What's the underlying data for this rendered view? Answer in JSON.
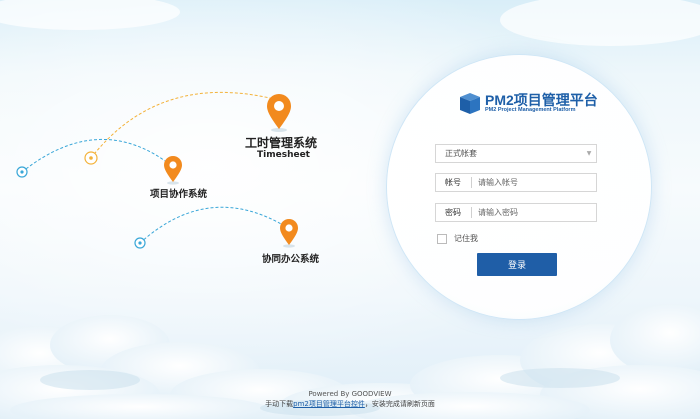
{
  "systems": [
    {
      "title": "工时管理系统",
      "subtitle": "Timesheet"
    },
    {
      "title": "项目协作系统"
    },
    {
      "title": "协同办公系统"
    }
  ],
  "brand": {
    "title": "PM2项目管理平台",
    "subtitle": "PM2 Project Management Platform",
    "color": "#1e5fa8"
  },
  "login": {
    "account_type": "正式帐套",
    "account_label": "帐号",
    "account_placeholder": "请输入帐号",
    "password_label": "密码",
    "password_placeholder": "请输入密码",
    "remember_label": "记住我",
    "submit_label": "登录",
    "button_color": "#1f5ea7"
  },
  "footer": {
    "powered_by": "Powered By GOODVIEW",
    "download_prefix": "手动下载",
    "download_link": "pm2项目管理平台控件",
    "download_suffix": "，安装完成请刷新页面"
  },
  "colors": {
    "pin_orange": "#f28a1e",
    "route_blue": "#3aa7d8",
    "route_orange": "#f3b23a"
  }
}
